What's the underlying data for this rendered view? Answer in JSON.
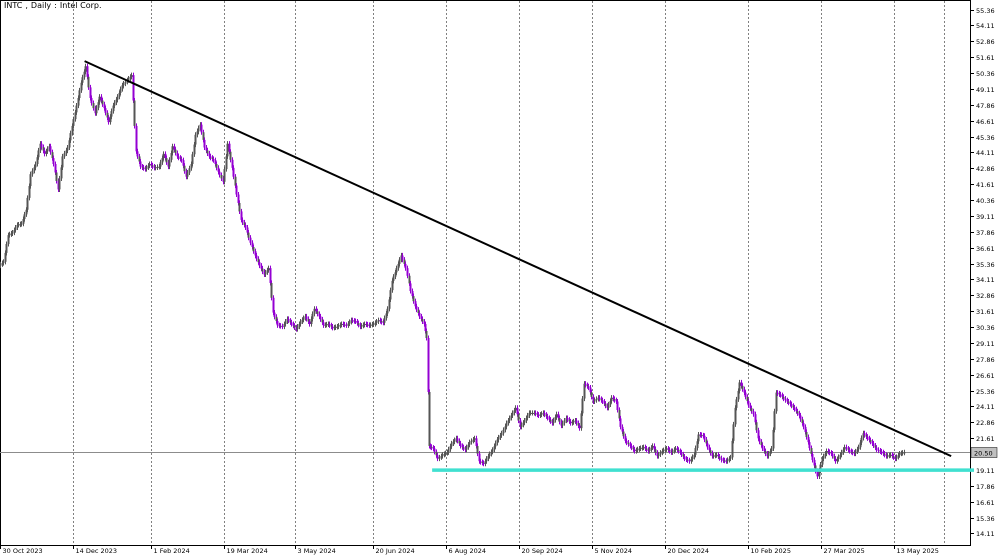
{
  "chart_data": {
    "type": "candlestick",
    "symbol": "INTC",
    "timeframe": "Daily",
    "description": "Intel Corp.",
    "y_ticks": [
      "55.36",
      "54.11",
      "52.86",
      "51.61",
      "50.36",
      "49.11",
      "47.86",
      "46.61",
      "45.36",
      "44.11",
      "42.86",
      "41.61",
      "40.36",
      "39.11",
      "37.86",
      "36.61",
      "35.36",
      "34.11",
      "32.86",
      "31.61",
      "30.36",
      "29.11",
      "27.86",
      "26.61",
      "25.36",
      "24.11",
      "22.86",
      "21.61",
      "19.11",
      "17.86",
      "16.61",
      "15.36",
      "14.11"
    ],
    "ylim": [
      13.2,
      55.8
    ],
    "x_ticks": [
      {
        "label": "30 Oct 2023",
        "x": 0
      },
      {
        "label": "14 Dec 2023",
        "x": 32
      },
      {
        "label": "1 Feb 2024",
        "x": 66
      },
      {
        "label": "19 Mar 2024",
        "x": 98
      },
      {
        "label": "3 May 2024",
        "x": 129
      },
      {
        "label": "20 Jun 2024",
        "x": 163
      },
      {
        "label": "6 Aug 2024",
        "x": 195
      },
      {
        "label": "20 Sep 2024",
        "x": 227
      },
      {
        "label": "5 Nov 2024",
        "x": 259
      },
      {
        "label": "20 Dec 2024",
        "x": 291
      },
      {
        "label": "10 Feb 2025",
        "x": 327
      },
      {
        "label": "27 Mar 2025",
        "x": 359
      },
      {
        "label": "13 May 2025",
        "x": 391
      }
    ],
    "xlim": [
      0,
      420
    ],
    "last_price": "20.50",
    "current_price": 20.5,
    "series": [
      {
        "name": "close",
        "points": [
          [
            0,
            35.5
          ],
          [
            2,
            37.6
          ],
          [
            4,
            37.8
          ],
          [
            6,
            38.4
          ],
          [
            8,
            38.5
          ],
          [
            10,
            39.6
          ],
          [
            12,
            42.4
          ],
          [
            14,
            43.2
          ],
          [
            16,
            44.8
          ],
          [
            18,
            44.0
          ],
          [
            20,
            44.6
          ],
          [
            22,
            43.2
          ],
          [
            24,
            41.2
          ],
          [
            26,
            43.8
          ],
          [
            28,
            44.5
          ],
          [
            30,
            46.2
          ],
          [
            32,
            47.8
          ],
          [
            34,
            49.6
          ],
          [
            36,
            50.9
          ],
          [
            38,
            48.4
          ],
          [
            40,
            47.2
          ],
          [
            42,
            48.5
          ],
          [
            44,
            47.6
          ],
          [
            46,
            46.5
          ],
          [
            48,
            47.8
          ],
          [
            50,
            48.5
          ],
          [
            52,
            49.4
          ],
          [
            54,
            49.8
          ],
          [
            56,
            50.2
          ],
          [
            58,
            44.2
          ],
          [
            60,
            43.0
          ],
          [
            62,
            42.8
          ],
          [
            64,
            43.2
          ],
          [
            66,
            42.9
          ],
          [
            68,
            43.0
          ],
          [
            70,
            44.0
          ],
          [
            72,
            43.0
          ],
          [
            74,
            44.6
          ],
          [
            76,
            43.8
          ],
          [
            78,
            43.5
          ],
          [
            80,
            42.2
          ],
          [
            82,
            43.2
          ],
          [
            84,
            45.5
          ],
          [
            86,
            46.3
          ],
          [
            88,
            44.5
          ],
          [
            90,
            43.8
          ],
          [
            92,
            43.5
          ],
          [
            94,
            42.6
          ],
          [
            96,
            41.8
          ],
          [
            98,
            44.8
          ],
          [
            100,
            42.9
          ],
          [
            102,
            40.8
          ],
          [
            104,
            38.8
          ],
          [
            106,
            38.2
          ],
          [
            108,
            37.0
          ],
          [
            110,
            36.0
          ],
          [
            112,
            35.2
          ],
          [
            114,
            34.5
          ],
          [
            116,
            35.0
          ],
          [
            118,
            31.5
          ],
          [
            120,
            30.5
          ],
          [
            122,
            30.4
          ],
          [
            124,
            31.0
          ],
          [
            126,
            30.6
          ],
          [
            128,
            30.2
          ],
          [
            130,
            30.8
          ],
          [
            132,
            31.2
          ],
          [
            134,
            30.6
          ],
          [
            136,
            31.8
          ],
          [
            138,
            31.2
          ],
          [
            140,
            30.5
          ],
          [
            142,
            30.6
          ],
          [
            144,
            30.3
          ],
          [
            146,
            30.4
          ],
          [
            148,
            30.6
          ],
          [
            150,
            30.5
          ],
          [
            152,
            30.9
          ],
          [
            154,
            30.8
          ],
          [
            156,
            30.4
          ],
          [
            158,
            30.6
          ],
          [
            160,
            30.5
          ],
          [
            162,
            30.6
          ],
          [
            164,
            30.9
          ],
          [
            166,
            30.7
          ],
          [
            168,
            31.8
          ],
          [
            170,
            34.0
          ],
          [
            172,
            35.0
          ],
          [
            174,
            36.0
          ],
          [
            176,
            35.0
          ],
          [
            178,
            33.2
          ],
          [
            180,
            32.0
          ],
          [
            182,
            31.2
          ],
          [
            184,
            30.6
          ],
          [
            186,
            29.5
          ],
          [
            187,
            21.0
          ],
          [
            188,
            20.8
          ],
          [
            190,
            20.0
          ],
          [
            192,
            20.3
          ],
          [
            194,
            20.5
          ],
          [
            196,
            21.2
          ],
          [
            198,
            21.6
          ],
          [
            200,
            21.0
          ],
          [
            202,
            20.7
          ],
          [
            204,
            21.3
          ],
          [
            206,
            21.6
          ],
          [
            208,
            19.8
          ],
          [
            210,
            19.6
          ],
          [
            212,
            20.2
          ],
          [
            214,
            20.7
          ],
          [
            216,
            21.5
          ],
          [
            218,
            22.0
          ],
          [
            220,
            22.8
          ],
          [
            222,
            23.4
          ],
          [
            224,
            24.0
          ],
          [
            226,
            22.5
          ],
          [
            228,
            23.0
          ],
          [
            230,
            23.6
          ],
          [
            232,
            23.6
          ],
          [
            234,
            23.4
          ],
          [
            236,
            23.6
          ],
          [
            238,
            23.2
          ],
          [
            240,
            22.8
          ],
          [
            242,
            23.5
          ],
          [
            244,
            22.6
          ],
          [
            246,
            23.2
          ],
          [
            248,
            22.8
          ],
          [
            250,
            23.0
          ],
          [
            252,
            22.4
          ],
          [
            254,
            25.9
          ],
          [
            256,
            25.6
          ],
          [
            258,
            24.5
          ],
          [
            260,
            24.8
          ],
          [
            262,
            24.5
          ],
          [
            264,
            24.0
          ],
          [
            266,
            24.8
          ],
          [
            268,
            24.5
          ],
          [
            270,
            22.5
          ],
          [
            272,
            21.4
          ],
          [
            274,
            21.0
          ],
          [
            276,
            20.6
          ],
          [
            278,
            20.8
          ],
          [
            280,
            20.9
          ],
          [
            282,
            20.6
          ],
          [
            284,
            21.0
          ],
          [
            286,
            20.2
          ],
          [
            288,
            20.6
          ],
          [
            290,
            20.8
          ],
          [
            292,
            20.5
          ],
          [
            294,
            20.8
          ],
          [
            296,
            20.5
          ],
          [
            298,
            20.0
          ],
          [
            300,
            19.8
          ],
          [
            302,
            20.3
          ],
          [
            304,
            21.9
          ],
          [
            306,
            21.8
          ],
          [
            308,
            20.9
          ],
          [
            310,
            20.2
          ],
          [
            312,
            20.3
          ],
          [
            314,
            19.9
          ],
          [
            316,
            19.8
          ],
          [
            318,
            20.1
          ],
          [
            320,
            24.0
          ],
          [
            322,
            26.0
          ],
          [
            324,
            25.2
          ],
          [
            326,
            24.2
          ],
          [
            328,
            23.5
          ],
          [
            330,
            21.6
          ],
          [
            332,
            20.8
          ],
          [
            334,
            20.2
          ],
          [
            336,
            20.8
          ],
          [
            338,
            25.2
          ],
          [
            340,
            25.0
          ],
          [
            342,
            24.6
          ],
          [
            344,
            24.3
          ],
          [
            346,
            23.9
          ],
          [
            348,
            23.4
          ],
          [
            350,
            22.5
          ],
          [
            352,
            21.3
          ],
          [
            354,
            19.9
          ],
          [
            356,
            18.6
          ],
          [
            358,
            20.0
          ],
          [
            360,
            20.6
          ],
          [
            362,
            20.4
          ],
          [
            364,
            19.8
          ],
          [
            366,
            20.3
          ],
          [
            368,
            20.9
          ],
          [
            370,
            20.6
          ],
          [
            372,
            20.4
          ],
          [
            374,
            20.9
          ],
          [
            376,
            22.0
          ],
          [
            378,
            21.6
          ],
          [
            380,
            21.2
          ],
          [
            382,
            20.7
          ],
          [
            384,
            20.5
          ],
          [
            386,
            20.2
          ],
          [
            388,
            20.3
          ],
          [
            390,
            20.0
          ],
          [
            392,
            20.4
          ],
          [
            394,
            20.5
          ]
        ]
      }
    ],
    "trendlines": [
      {
        "name": "descending resistance",
        "color": "#000000",
        "from": [
          37,
          51.3
        ],
        "to": [
          416,
          20.2
        ]
      },
      {
        "name": "support",
        "color": "#40e0d0",
        "from": [
          189,
          19.1
        ],
        "to": [
          426,
          19.1
        ]
      }
    ],
    "colors": {
      "bull": "#555555",
      "bear": "#9400d3",
      "grid": "#808080",
      "text": "#000000"
    }
  }
}
